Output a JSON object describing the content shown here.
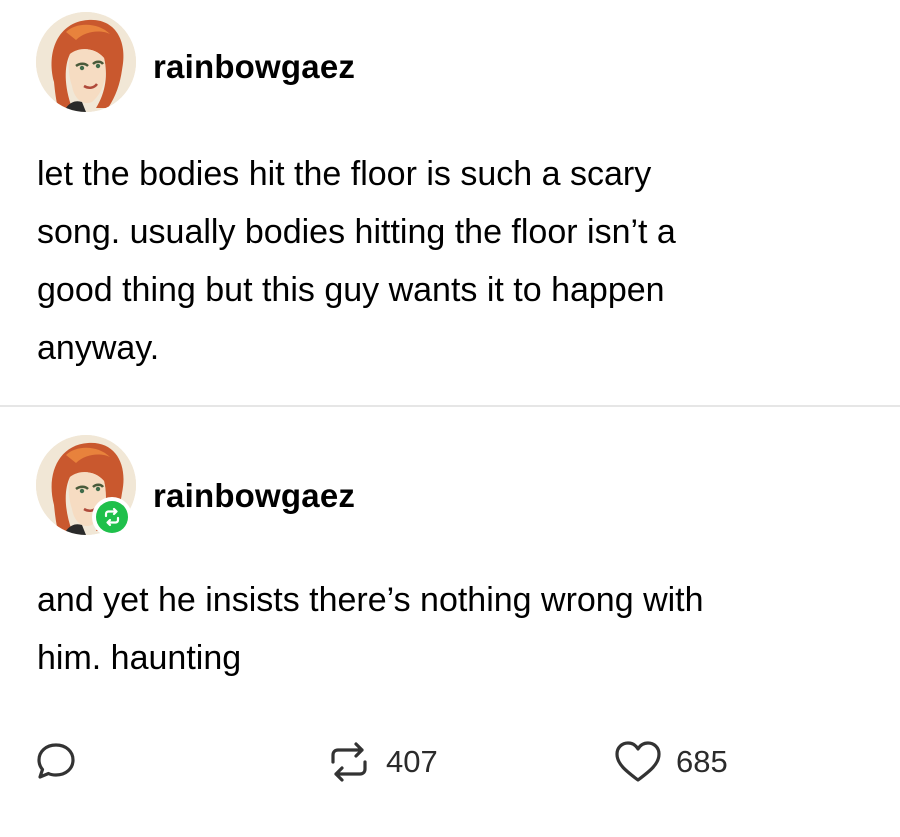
{
  "posts": [
    {
      "username": "rainbowgaez",
      "avatar_icon": "illustrated-woman-avatar",
      "lines": [
        "let the bodies hit the floor is such a scary",
        "song. usually bodies hitting the floor isn’t a",
        "good thing but this guy wants it to happen",
        "anyway."
      ]
    },
    {
      "username": "rainbowgaez",
      "avatar_icon": "illustrated-woman-avatar",
      "badge_icon": "reblog-icon",
      "lines": [
        "and yet he insists there’s nothing wrong with",
        "him. haunting"
      ]
    }
  ],
  "footer": {
    "reply_icon": "speech-bubble-icon",
    "reblog_icon": "reblog-icon",
    "reblog_count": "407",
    "like_icon": "heart-icon",
    "like_count": "685"
  },
  "colors": {
    "reblog_badge": "#1fc04b",
    "divider": "#e6e6e6",
    "text": "#000000"
  }
}
